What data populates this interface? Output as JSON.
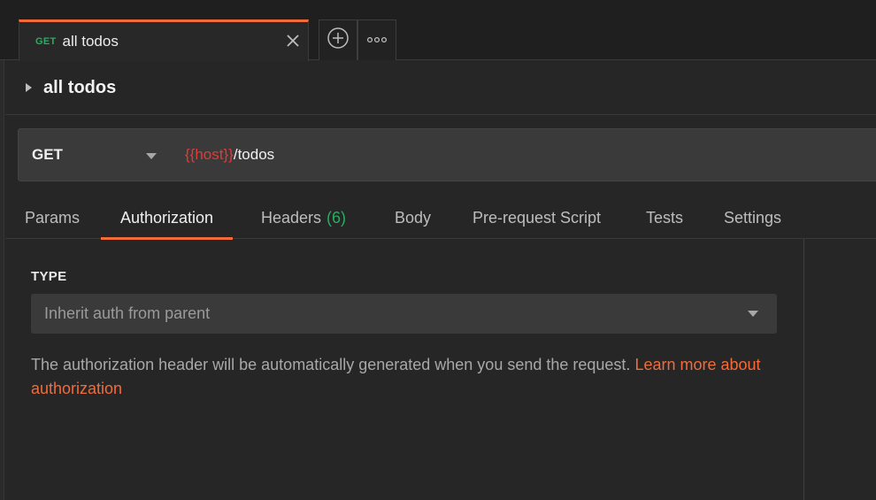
{
  "tab": {
    "method": "GET",
    "name": "all todos"
  },
  "breadcrumb": {
    "title": "all todos"
  },
  "request": {
    "method": "GET",
    "url_variable": "{{host}}",
    "url_path": "/todos"
  },
  "request_tabs": [
    {
      "label": "Params"
    },
    {
      "label": "Authorization",
      "active": true
    },
    {
      "label": "Headers",
      "count": "(6)"
    },
    {
      "label": "Body"
    },
    {
      "label": "Pre-request Script"
    },
    {
      "label": "Tests"
    },
    {
      "label": "Settings"
    }
  ],
  "auth": {
    "type_label": "TYPE",
    "selected": "Inherit auth from parent",
    "description": "The authorization header will be automatically generated when you send the request.",
    "link_text": "Learn more about authorization"
  },
  "colors": {
    "accent": "#f26b3a",
    "method_get": "#27ae60",
    "variable": "#e53935"
  },
  "icons": {
    "close": "close-icon",
    "add": "plus-circle-icon",
    "more": "more-horizontal-icon",
    "caret": "caret-right-icon",
    "dropdown": "chevron-down-icon"
  }
}
